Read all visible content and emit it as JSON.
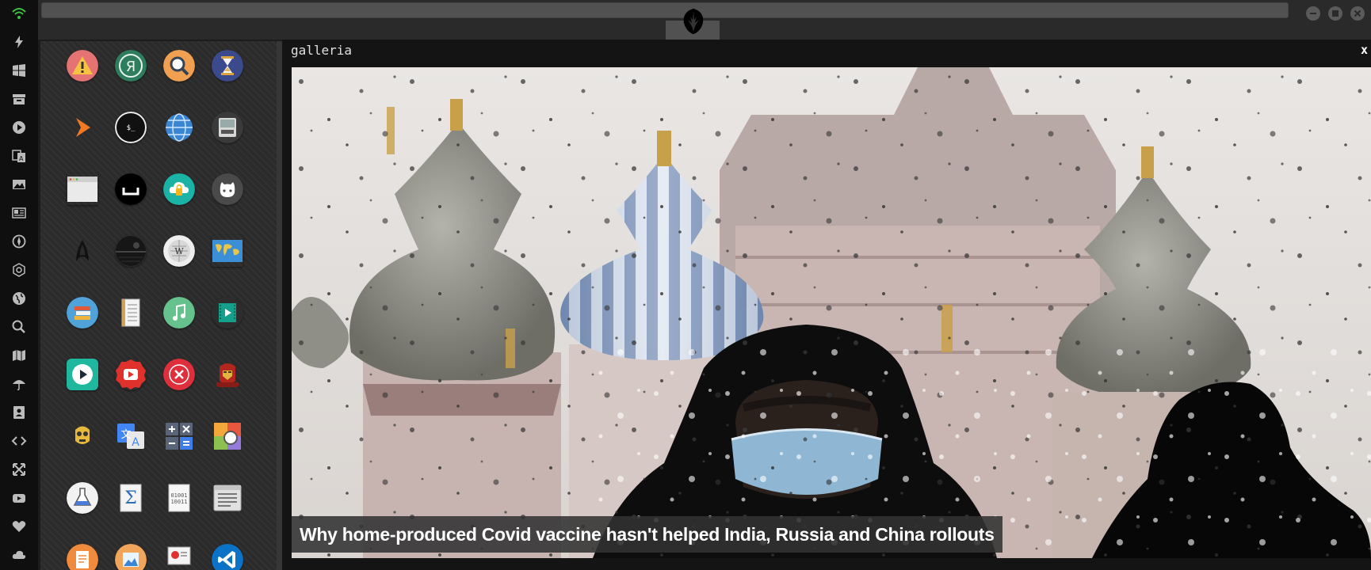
{
  "dock": {
    "icons": [
      "wifi-icon",
      "lightning-icon",
      "windows-icon",
      "archive-icon",
      "play-icon",
      "translate-icon",
      "image-icon",
      "newspaper-icon",
      "rebel-icon",
      "hexagon-icon",
      "globe-icon",
      "search-icon",
      "map-icon",
      "umbrella-icon",
      "contacts-icon",
      "code-icon",
      "expand-icon",
      "youtube-icon",
      "heart-icon",
      "cloud-icon"
    ]
  },
  "drawer": {
    "apps": [
      [
        "warning-app-icon",
        "yandex-app-icon",
        "search-app-icon",
        "hourglass-app-icon"
      ],
      [
        "sublime-app-icon",
        "terminal-app-icon",
        "globe-app-icon",
        "disk-app-icon"
      ],
      [
        "window-app-icon",
        "eject-app-icon",
        "cloud-lock-app-icon",
        "github-app-icon"
      ],
      [
        "star-trek-app-icon",
        "death-star-app-icon",
        "wikipedia-app-icon",
        "world-map-app-icon"
      ],
      [
        "books-app-icon",
        "notebook-app-icon",
        "music-app-icon",
        "video-app-icon"
      ],
      [
        "play-app-icon",
        "youtube-app-icon",
        "close-app-icon",
        "iron-man-app-icon"
      ],
      [
        "c3po-app-icon",
        "translate-app-icon",
        "calculator-app-icon",
        "color-picker-app-icon"
      ],
      [
        "flask-app-icon",
        "sigma-app-icon",
        "binary-app-icon",
        "text-editor-app-icon"
      ],
      [
        "document-app-icon",
        "photo-app-icon",
        "presentation-app-icon",
        "vscode-app-icon"
      ]
    ]
  },
  "gallery": {
    "title": "galleria",
    "close_label": "x",
    "caption": "Why home-produced Covid vaccine hasn't helped India, Russia and China rollouts"
  },
  "colors": {
    "dock_bg": "#0f0f0f",
    "accent_green": "#3fbf3f",
    "drawer_bg": "#2b2b2b",
    "caption_bg": "#323232"
  }
}
